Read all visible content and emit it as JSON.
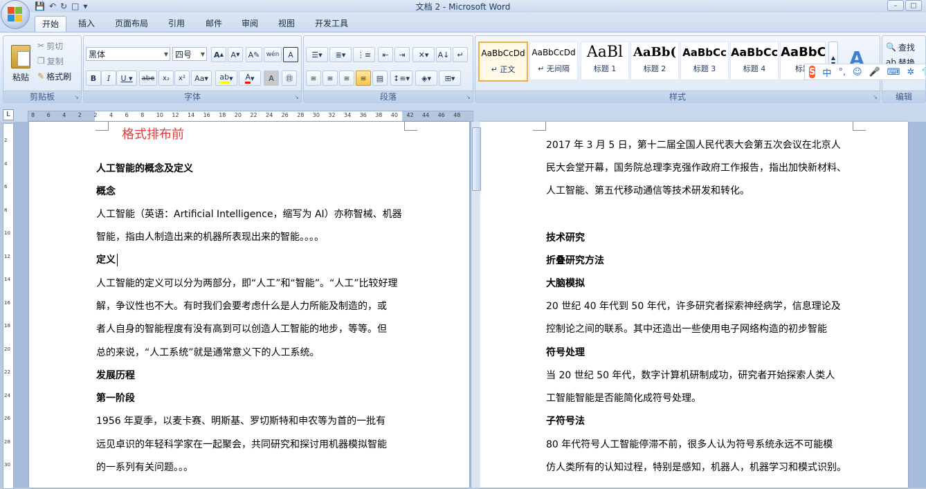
{
  "window": {
    "title": "文档 2 - Microsoft Word"
  },
  "qat": {
    "save_icon": "save-icon",
    "undo_icon": "undo-icon",
    "redo_icon": "redo-icon",
    "print_preview_icon": "print-preview-icon"
  },
  "tabs": [
    "开始",
    "插入",
    "页面布局",
    "引用",
    "邮件",
    "审阅",
    "视图",
    "开发工具"
  ],
  "clipboard": {
    "paste": "粘贴",
    "cut": "剪切",
    "copy": "复制",
    "format_painter": "格式刷",
    "label": "剪贴板"
  },
  "font": {
    "name": "黑体",
    "size": "四号",
    "label": "字体"
  },
  "paragraph": {
    "label": "段落"
  },
  "styles": {
    "label": "样式",
    "items": [
      {
        "preview": "AaBbCcDd",
        "name": "↵ 正文"
      },
      {
        "preview": "AaBbCcDd",
        "name": "↵ 无间隔"
      },
      {
        "preview": "AaBl",
        "name": "标题 1"
      },
      {
        "preview": "AaBb(",
        "name": "标题 2"
      },
      {
        "preview": "AaBbCc",
        "name": "标题 3"
      },
      {
        "preview": "AaBbCc",
        "name": "标题 4"
      },
      {
        "preview": "AaBbC",
        "name": "标题"
      }
    ]
  },
  "editing": {
    "find": "查找",
    "replace": "替换",
    "label": "编辑"
  },
  "ime": {
    "lang": "中"
  },
  "ruler": {
    "hticks": [
      "8",
      "6",
      "4",
      "2",
      "2",
      "4",
      "6",
      "8",
      "10",
      "12",
      "14",
      "16",
      "18",
      "20",
      "22",
      "24",
      "26",
      "28",
      "30",
      "32",
      "34",
      "36",
      "38",
      "40",
      "42",
      "44",
      "46",
      "48"
    ],
    "vticks": [
      "2",
      "4",
      "6",
      "8",
      "10",
      "12",
      "14",
      "16",
      "18",
      "20",
      "22",
      "24",
      "26",
      "28",
      "30"
    ]
  },
  "left_page": {
    "heading": "格式排布前",
    "lines": [
      "人工智能的概念及定义",
      "概念",
      "人工智能（英语：Artificial Intelligence，缩写为 AI）亦称智械、机器",
      "智能，指由人制造出来的机器所表现出来的智能。。。。",
      "定义",
      "人工智能的定义可以分为两部分，即“人工”和“智能”。“人工”比较好理",
      "解，争议性也不大。有时我们会要考虑什么是人力所能及制造的，或",
      "者人自身的智能程度有没有高到可以创造人工智能的地步，等等。但",
      "总的来说，“人工系统”就是通常意义下的人工系统。",
      "发展历程",
      "第一阶段",
      "1956 年夏季，以麦卡赛、明斯基、罗切斯特和申农等为首的一批有",
      "远见卓识的年轻科学家在一起聚会，共同研究和探讨用机器模拟智能",
      "的一系列有关问题。。。"
    ]
  },
  "right_page": {
    "lines": [
      "2017 年 3 月 5 日，第十二届全国人民代表大会第五次会议在北京人",
      "民大会堂开幕，国务院总理李克强作政府工作报告，指出加快新材料、",
      "人工智能、第五代移动通信等技术研发和转化。",
      "",
      "技术研究",
      "折叠研究方法",
      "大脑模拟",
      "20 世纪 40 年代到 50 年代，许多研究者探索神经病学，信息理论及",
      "控制论之间的联系。其中还造出一些使用电子网络构造的初步智能",
      "符号处理",
      "当 20 世纪 50 年代，数字计算机研制成功，研究者开始探索人类人",
      "工智能智能是否能简化成符号处理。",
      "子符号法",
      "80 年代符号人工智能停滞不前，很多人认为符号系统永远不可能模",
      "仿人类所有的认知过程，特别是感知，机器人，机器学习和模式识别。"
    ]
  }
}
